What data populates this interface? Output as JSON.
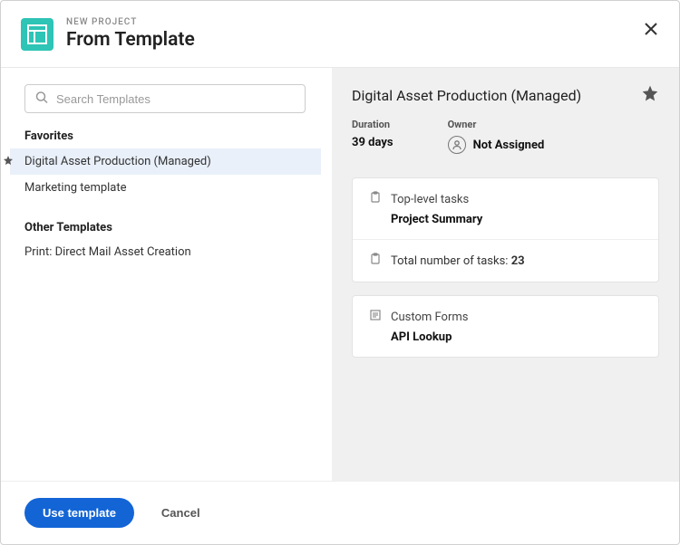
{
  "header": {
    "eyebrow": "NEW PROJECT",
    "title": "From Template"
  },
  "search": {
    "placeholder": "Search Templates"
  },
  "sections": {
    "favorites_label": "Favorites",
    "other_label": "Other Templates"
  },
  "favorites": [
    {
      "label": "Digital Asset Production (Managed)",
      "starred": true,
      "selected": true
    },
    {
      "label": "Marketing template",
      "starred": false,
      "selected": false
    }
  ],
  "other": [
    {
      "label": "Print: Direct Mail Asset Creation"
    }
  ],
  "detail": {
    "title": "Digital Asset Production (Managed)",
    "duration_label": "Duration",
    "duration_value": "39 days",
    "owner_label": "Owner",
    "owner_value": "Not Assigned",
    "tasks_card": {
      "top_label": "Top-level tasks",
      "top_value": "Project Summary",
      "total_label": "Total number of tasks:",
      "total_value": "23"
    },
    "forms_card": {
      "label": "Custom Forms",
      "value": "API Lookup"
    }
  },
  "footer": {
    "use_label": "Use template",
    "cancel_label": "Cancel"
  }
}
